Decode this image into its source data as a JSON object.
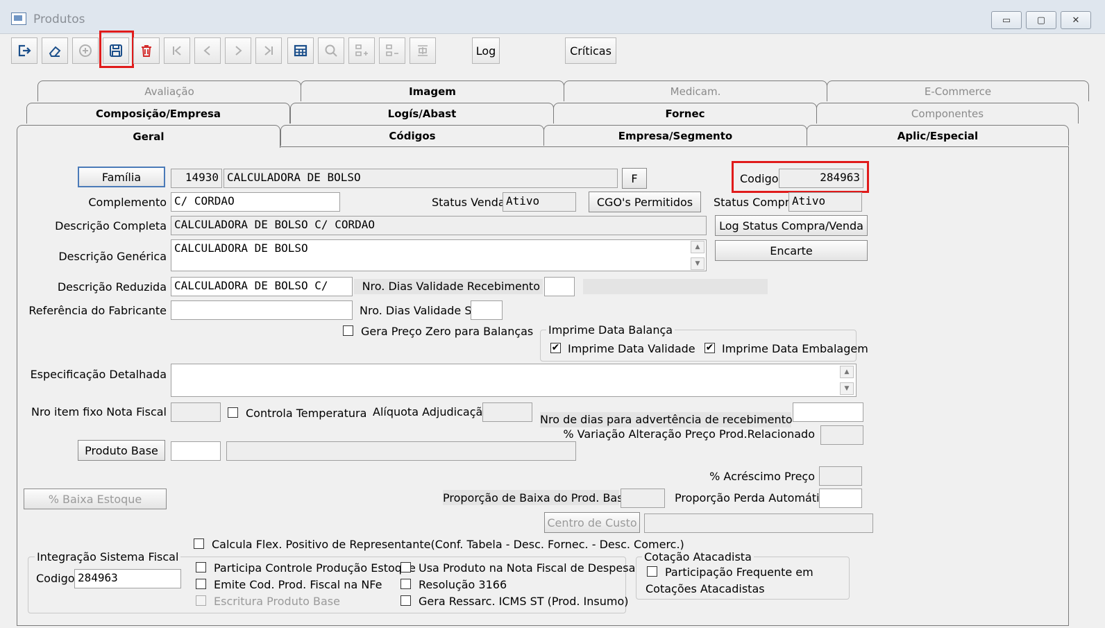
{
  "window": {
    "title": "Produtos",
    "controls": [
      "▭",
      "▢",
      "✕"
    ]
  },
  "toolbar": {
    "log_label": "Log",
    "criticas_label": "Críticas"
  },
  "tabs": {
    "row1": [
      "Avaliação",
      "Imagem",
      "Medicam.",
      "E-Commerce"
    ],
    "row2": [
      "Composição/Empresa",
      "Logís/Abast",
      "Fornec",
      "Componentes"
    ],
    "row3": [
      "Geral",
      "Códigos",
      "Empresa/Segmento",
      "Aplic/Especial"
    ]
  },
  "form": {
    "familia_button": "Família",
    "familia_code": "14930",
    "familia_desc": "CALCULADORA DE BOLSO",
    "f_button": "F",
    "codigo_label": "Codigo",
    "codigo_value": "284963",
    "complemento_label": "Complemento",
    "complemento_value": "C/ CORDAO",
    "status_venda_label": "Status Venda",
    "status_venda_value": "Ativo",
    "cgo_button": "CGO's Permitidos",
    "status_compra_label": "Status Compra",
    "status_compra_value": "Ativo",
    "desc_completa_label": "Descrição Completa",
    "desc_completa_value": "CALCULADORA DE BOLSO C/ CORDAO",
    "log_status_button": "Log Status Compra/Venda",
    "desc_generica_label": "Descrição Genérica",
    "desc_generica_value": "CALCULADORA DE BOLSO",
    "encarte_button": "Encarte",
    "desc_reduzida_label": "Descrição Reduzida",
    "desc_reduzida_value": "CALCULADORA DE BOLSO C/",
    "dias_validade_receb_label": "Nro. Dias Validade Recebimento",
    "ref_fabricante_label": "Referência do Fabricante",
    "dias_validade_sa_label": "Nro. Dias Validade Sa",
    "gera_preco_zero_label": "Gera Preço Zero para Balanças",
    "imprime_data_balanca_label": "Imprime Data Balança",
    "imprime_data_validade_label": "Imprime Data Validade",
    "imprime_data_embalagem_label": "Imprime Data Embalagem",
    "especificacao_label": "Especificação Detalhada",
    "nro_item_fixo_label": "Nro item fixo Nota Fiscal",
    "controla_temp_label": "Controla Temperatura",
    "aliquota_label": "Alíquota Adjudicação",
    "nro_dias_advertencia_label": "Nro de dias para advertência de recebimento",
    "variacao_label": "% Variação Alteração Preço Prod.Relacionado",
    "produto_base_button": "Produto Base",
    "acrescimo_label": "% Acréscimo Preço",
    "baixa_estoque_button": "% Baixa Estoque",
    "proporcao_baixa_label": "Proporção de Baixa do Prod. Base",
    "proporcao_perda_label": "Proporção Perda Automática",
    "centro_custo_button": "Centro de Custo",
    "calcula_flex_label": "Calcula Flex. Positivo de Representante(Conf. Tabela - Desc. Fornec. - Desc. Comerc.)",
    "integracao_label": "Integração Sistema Fiscal",
    "integracao_codigo_label": "Codigo",
    "integracao_codigo_value": "284963",
    "participa_controle_label": "Participa Controle Produção Estoque",
    "emite_cod_label": "Emite Cod. Prod. Fiscal na NFe",
    "escritura_label": "Escritura Produto Base",
    "usa_produto_label": "Usa Produto na Nota Fiscal de Despesa",
    "resolucao_label": "Resolução 3166",
    "gera_ressarc_label": "Gera Ressarc. ICMS ST (Prod. Insumo)",
    "cotacao_label": "Cotação Atacadista",
    "participacao_freq_label_1": "Participação Frequente em",
    "participacao_freq_label_2": "Cotações Atacadistas"
  },
  "checks": {
    "imprime_data_validade": "✔",
    "imprime_data_embalagem": "✔"
  }
}
